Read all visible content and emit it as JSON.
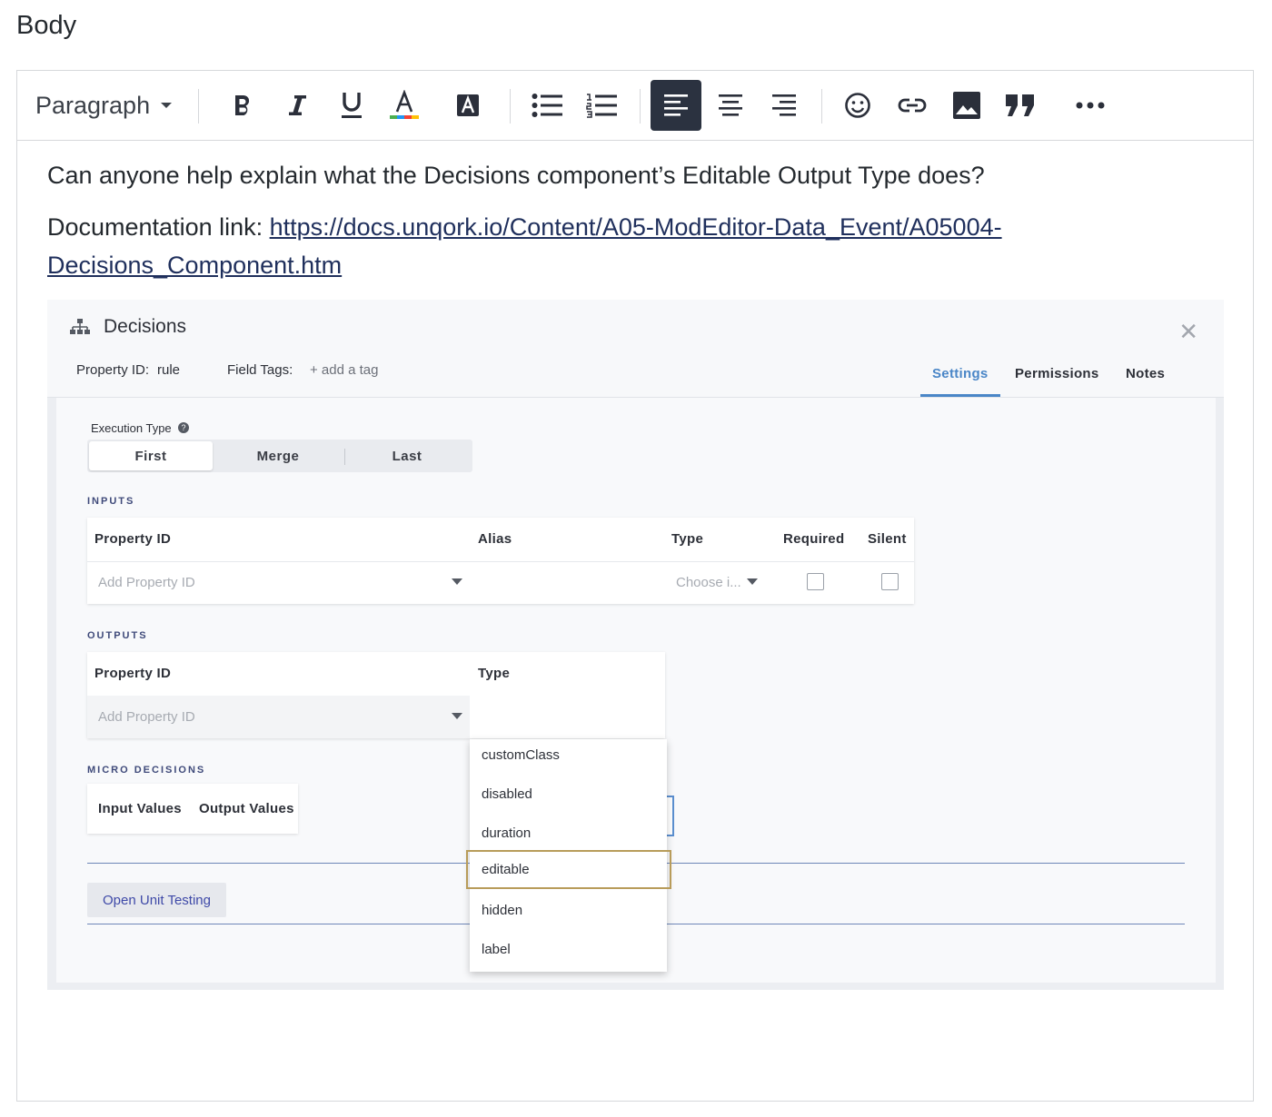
{
  "page": {
    "field_label": "Body"
  },
  "toolbar": {
    "paragraph_label": "Paragraph",
    "icons": [
      "bold-icon",
      "italic-icon",
      "underline-icon",
      "text-color-icon",
      "highlight-icon",
      "bullet-list-icon",
      "numbered-list-icon",
      "align-left-icon",
      "align-center-icon",
      "align-right-icon",
      "emoji-icon",
      "link-icon",
      "image-icon",
      "quote-icon",
      "more-icon"
    ],
    "active": "align-left-icon",
    "colors": {
      "active_bg": "#2b3240",
      "text_color_bar": [
        "#4caf50",
        "#2196f3",
        "#f44336",
        "#ffc107"
      ]
    }
  },
  "content": {
    "line1": "Can anyone help explain what the Decisions component’s Editable Output Type does?",
    "doc_prefix": "Documentation link: ",
    "doc_link": "https://docs.unqork.io/Content/A05-ModEditor-Data_Event/A05004-Decisions_Component.htm",
    "doc_link_part1": "https://docs.unqork.io/Content/A05-ModEditor-Data_Event/A05004-",
    "doc_link_part2": "Decisions_Component.htm"
  },
  "screenshot": {
    "title": "Decisions",
    "property_id_label": "Property ID:",
    "property_id_value": "rule",
    "field_tags_label": "Field Tags:",
    "add_tag": "+ add a tag",
    "tabs": [
      "Settings",
      "Permissions",
      "Notes"
    ],
    "active_tab": "Settings",
    "execution_type_label": "Execution Type",
    "execution_options": [
      "First",
      "Merge",
      "Last"
    ],
    "execution_selected": "First",
    "inputs": {
      "section": "INPUTS",
      "columns": [
        "Property ID",
        "Alias",
        "Type",
        "Required",
        "Silent"
      ],
      "property_placeholder": "Add Property ID",
      "type_placeholder": "Choose i..."
    },
    "outputs": {
      "section": "OUTPUTS",
      "columns": [
        "Property ID",
        "Type"
      ],
      "property_placeholder": "Add Property ID",
      "type_value": ""
    },
    "micro": {
      "section": "MICRO DECISIONS",
      "tabs": [
        "Input Values",
        "Output Values"
      ]
    },
    "unit_testing_button": "Open Unit Testing",
    "type_options": [
      "customClass",
      "disabled",
      "duration",
      "editable",
      "hidden",
      "label"
    ],
    "highlighted_option": "editable",
    "colors": {
      "accent": "#4a86c7",
      "focus": "#5b8fd0",
      "highlight_border": "#b89c5a",
      "section_text": "#3f4a7a"
    }
  }
}
